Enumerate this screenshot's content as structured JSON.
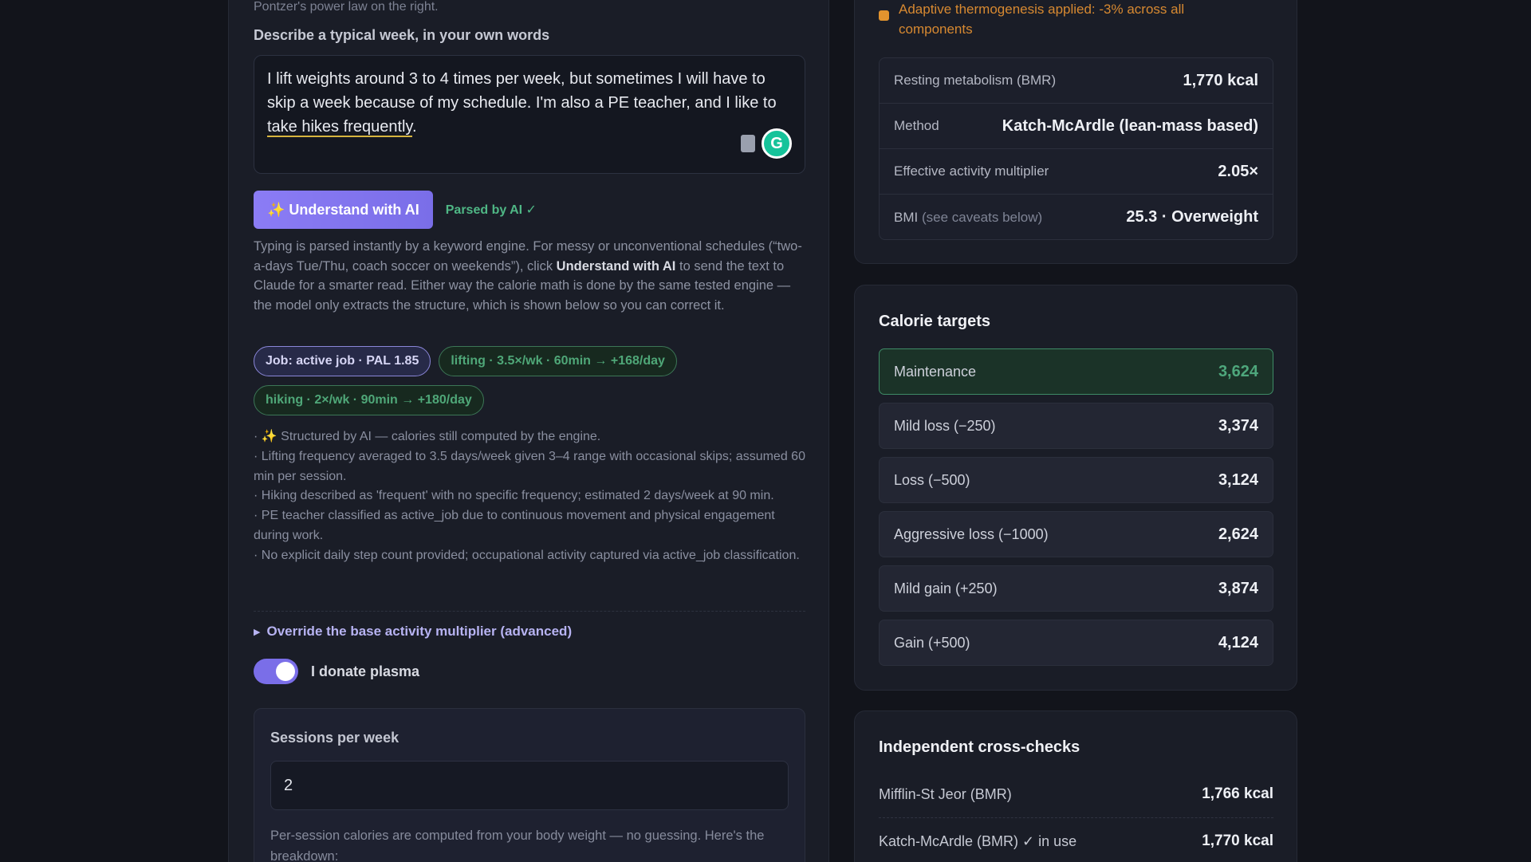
{
  "left": {
    "top_text": "Pontzer's power law on the right.",
    "week_label": "Describe a typical week, in your own words",
    "week_text_a": "I lift weights around 3 to 4 times per week, but sometimes I will have to skip a week because of my schedule. I'm also a PE teacher, and I like to ",
    "week_text_link": "take hikes frequently",
    "week_text_b": ".",
    "ai_button": "✨ Understand with AI",
    "parsed_status": "Parsed by AI ✓",
    "help_1": "Typing is parsed instantly by a keyword engine. For messy or unconventional schedules (“two-a-days Tue/Thu, coach soccer on weekends”), click ",
    "help_bold": "Understand with AI",
    "help_2": " to send the text to Claude for a smarter read. Either way the calorie math is done by the same tested engine — the model only extracts the structure, which is shown below so you can correct it.",
    "chips": {
      "job": "Job: active job · PAL 1.85",
      "lifting": "lifting · 3.5×/wk · 60min → +168/day",
      "hiking": "hiking · 2×/wk · 90min → +180/day"
    },
    "notes": [
      "· ✨ Structured by AI — calories still computed by the engine.",
      "· Lifting frequency averaged to 3.5 days/week given 3–4 range with occasional skips; assumed 60 min per session.",
      "· Hiking described as 'frequent' with no specific frequency; estimated 2 days/week at 90 min.",
      "· PE teacher classified as active_job due to continuous movement and physical engagement during work.",
      "· No explicit daily step count provided; occupational activity captured via active_job classification."
    ],
    "override_label": "Override the base activity multiplier (advanced)",
    "plasma_label": "I donate plasma",
    "plasma_on": true,
    "sessions_label": "Sessions per week",
    "sessions_value": "2",
    "sessions_help": "Per-session calories are computed from your body weight — no guessing. Here's the breakdown:"
  },
  "summary": {
    "warning": "Adaptive thermogenesis applied: -3% across all components",
    "rows": [
      {
        "label": "Resting metabolism (BMR)",
        "value": "1,770 kcal"
      },
      {
        "label": "Method",
        "value": "Katch-McArdle (lean-mass based)"
      },
      {
        "label": "Effective activity multiplier",
        "value": "2.05×"
      },
      {
        "label": "BMI",
        "label_note": "(see caveats below)",
        "value": "25.3 · Overweight"
      }
    ]
  },
  "targets": {
    "title": "Calorie targets",
    "rows": [
      {
        "label": "Maintenance",
        "value": "3,624"
      },
      {
        "label": "Mild loss (−250)",
        "value": "3,374"
      },
      {
        "label": "Loss (−500)",
        "value": "3,124"
      },
      {
        "label": "Aggressive loss (−1000)",
        "value": "2,624"
      },
      {
        "label": "Mild gain (+250)",
        "value": "3,874"
      },
      {
        "label": "Gain (+500)",
        "value": "4,124"
      }
    ]
  },
  "checks": {
    "title": "Independent cross-checks",
    "rows": [
      {
        "label": "Mifflin-St Jeor (BMR)",
        "value": "1,766 kcal"
      },
      {
        "label": "Katch-McArdle (BMR) ✓ in use",
        "value": "1,770 kcal"
      }
    ]
  },
  "colors": {
    "accent": "#7a6ee8",
    "success": "#4fb785",
    "warning": "#e2932e",
    "background": "#12141b"
  }
}
